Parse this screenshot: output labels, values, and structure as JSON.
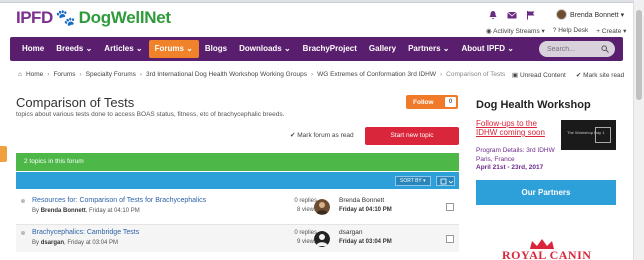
{
  "logo": {
    "part1": "IPFD",
    "paw": "🐾",
    "part2": "DogWellNet"
  },
  "user": {
    "name": "Brenda Bonnett ▾"
  },
  "top_links": {
    "streams": "Activity Streams ▾",
    "help": "Help Desk",
    "create": "+ Create ▾"
  },
  "nav": {
    "items": [
      "Home",
      "Breeds ⌄",
      "Articles ⌄",
      "Forums ⌄",
      "Blogs",
      "Downloads ⌄",
      "BrachyProject",
      "Gallery",
      "Partners ⌄",
      "About IPFD ⌄"
    ],
    "active_index": 3,
    "search_placeholder": "Search..."
  },
  "breadcrumb": [
    "Home",
    "Forums",
    "Specialty Forums",
    "3rd International Dog Health Workshop Working Groups",
    "WG Extremes of Conformation 3rd IDHW",
    "Comparison of Tests"
  ],
  "crumb_actions": {
    "unread": "Unread Content",
    "mark": "Mark site read"
  },
  "forum": {
    "title": "Comparison of Tests",
    "description": "topics about various tests done to access BOAS status, fitness, etc of brachycephalic breeds.",
    "follow_label": "Follow",
    "follow_count": "0",
    "mark_read": "✔ Mark forum as read",
    "new_topic": "Start new topic",
    "topics_count": "2 topics in this forum",
    "sort_label": "SORT BY ▾"
  },
  "topics": [
    {
      "title": "Resources for: Comparison of Tests for Brachycephalics",
      "by_prefix": "By",
      "author": "Brenda Bonnett",
      "date": ", Friday at 04:10 PM",
      "replies": "0 replies",
      "views": "8 views",
      "last_name": "Brenda Bonnett",
      "last_date": "Friday at 04:10 PM"
    },
    {
      "title": "Brachycephalics: Cambridge Tests",
      "by_prefix": "By",
      "author": "dsargan",
      "date": ", Friday at 03:04 PM",
      "replies": "0 replies",
      "views": "9 views",
      "last_name": "dsargan",
      "last_date": "Friday at 03:04 PM"
    }
  ],
  "sidebar": {
    "title": "Dog Health Workshop",
    "link": "Follow-ups to the IDHW coming soon",
    "image_text": "The Workshop Day 1",
    "details": "Program Details: 3rd IDHW  Paris, France",
    "dates": "April 21st - 23rd, 2017",
    "partners": "Our Partners",
    "royal": "ROYAL CANIN"
  },
  "colors": {
    "nav": "#5a1e6e",
    "accent": "#f0822a",
    "green": "#4db848",
    "blue": "#2d9fd9",
    "red": "#d9263a"
  }
}
